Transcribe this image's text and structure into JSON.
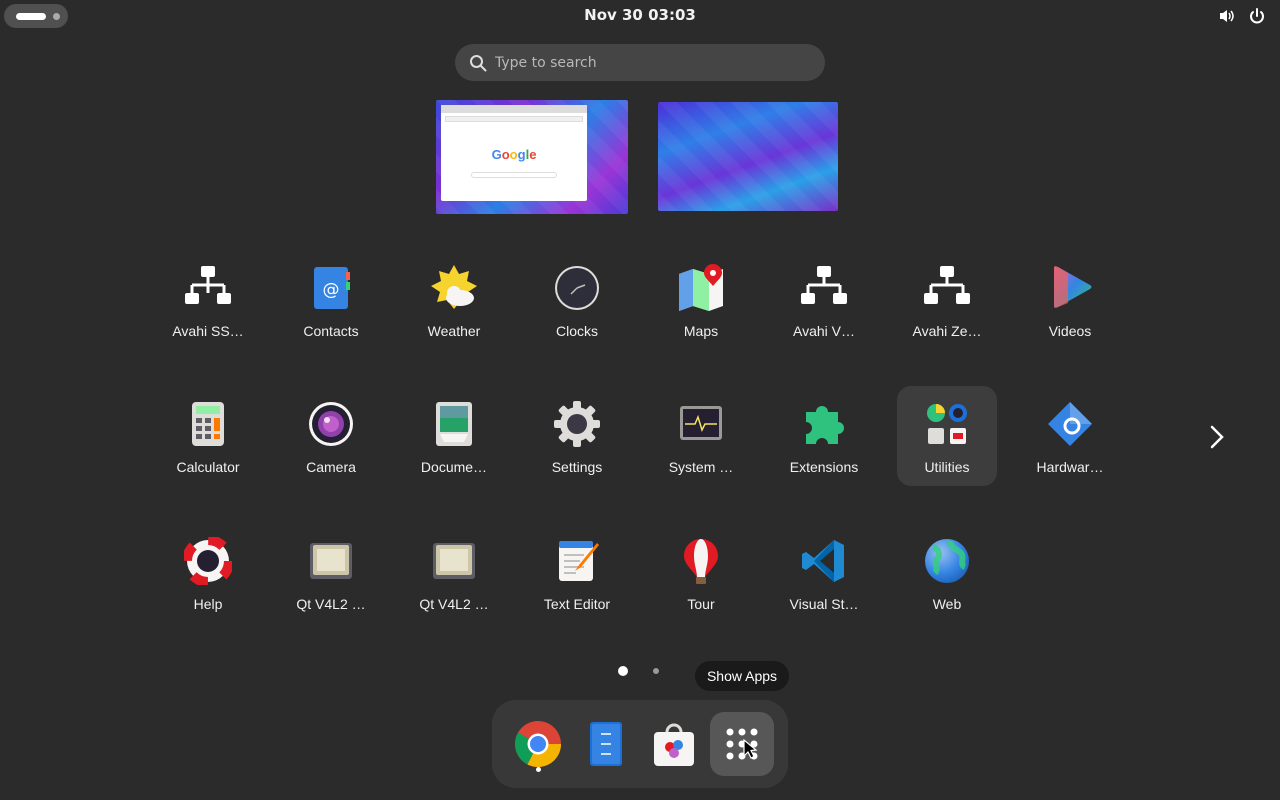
{
  "topbar": {
    "clock": "Nov 30  03:03",
    "activities_icon": "activities-pill-icon",
    "tray_icons": [
      "volume-icon",
      "power-icon"
    ]
  },
  "search": {
    "placeholder": "Type to search",
    "value": "",
    "icon": "search-icon"
  },
  "workspaces": [
    {
      "index": 1,
      "window": "Google",
      "google_logo": [
        "G",
        "o",
        "o",
        "g",
        "l",
        "e"
      ]
    },
    {
      "index": 2,
      "window": ""
    }
  ],
  "apps": [
    {
      "label": "Avahi SS…",
      "icon": "network-icon"
    },
    {
      "label": "Contacts",
      "icon": "contacts-icon"
    },
    {
      "label": "Weather",
      "icon": "weather-icon"
    },
    {
      "label": "Clocks",
      "icon": "clock-icon"
    },
    {
      "label": "Maps",
      "icon": "maps-icon"
    },
    {
      "label": "Avahi V…",
      "icon": "network-icon"
    },
    {
      "label": "Avahi Ze…",
      "icon": "network-icon"
    },
    {
      "label": "Videos",
      "icon": "videos-icon"
    },
    {
      "label": "Calculator",
      "icon": "calculator-icon"
    },
    {
      "label": "Camera",
      "icon": "camera-icon"
    },
    {
      "label": "Docume…",
      "icon": "document-scanner-icon"
    },
    {
      "label": "Settings",
      "icon": "gear-icon"
    },
    {
      "label": "System …",
      "icon": "system-monitor-icon"
    },
    {
      "label": "Extensions",
      "icon": "puzzle-icon"
    },
    {
      "label": "Utilities",
      "icon": "folder-grid-icon"
    },
    {
      "label": "Hardwar…",
      "icon": "hardware-icon"
    },
    {
      "label": "Help",
      "icon": "lifebuoy-icon"
    },
    {
      "label": "Qt V4L2 …",
      "icon": "webcam-icon"
    },
    {
      "label": "Qt V4L2 …",
      "icon": "webcam-icon"
    },
    {
      "label": "Text Editor",
      "icon": "text-editor-icon"
    },
    {
      "label": "Tour",
      "icon": "balloon-icon"
    },
    {
      "label": "Visual St…",
      "icon": "vscode-icon"
    },
    {
      "label": "Web",
      "icon": "globe-icon"
    }
  ],
  "pagination": {
    "pages": 2,
    "current": 1
  },
  "tooltip": {
    "text": "Show Apps"
  },
  "dock": {
    "items": [
      {
        "name": "Google Chrome",
        "icon": "chrome-icon",
        "running": true
      },
      {
        "name": "Files",
        "icon": "files-icon",
        "running": false
      },
      {
        "name": "Software",
        "icon": "software-store-icon",
        "running": false
      },
      {
        "name": "Show Apps",
        "icon": "app-grid-icon",
        "active": true
      }
    ]
  },
  "colors": {
    "background": "#2b2b2b",
    "search_bg": "#454545",
    "dock_bg": "#383838",
    "highlight": "#3d3d3d"
  }
}
